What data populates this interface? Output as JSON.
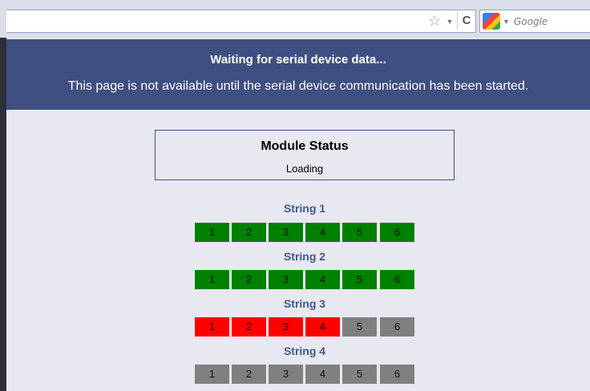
{
  "browser": {
    "search_placeholder": "Google",
    "star_icon": "star-icon",
    "reload_icon": "reload-icon"
  },
  "banner": {
    "title": "Waiting for serial device data...",
    "message": "This page is not available until the serial device communication has been started."
  },
  "module_status": {
    "title": "Module Status",
    "status": "Loading"
  },
  "colors": {
    "banner": "#3e4f82",
    "ok": "#008000",
    "fault": "#ff0000",
    "inactive": "#808080"
  },
  "strings": [
    {
      "label": "String 1",
      "modules": [
        {
          "num": "1",
          "state": "ok"
        },
        {
          "num": "2",
          "state": "ok"
        },
        {
          "num": "3",
          "state": "ok"
        },
        {
          "num": "4",
          "state": "ok"
        },
        {
          "num": "5",
          "state": "ok"
        },
        {
          "num": "6",
          "state": "ok"
        }
      ]
    },
    {
      "label": "String 2",
      "modules": [
        {
          "num": "1",
          "state": "ok"
        },
        {
          "num": "2",
          "state": "ok"
        },
        {
          "num": "3",
          "state": "ok"
        },
        {
          "num": "4",
          "state": "ok"
        },
        {
          "num": "5",
          "state": "ok"
        },
        {
          "num": "6",
          "state": "ok"
        }
      ]
    },
    {
      "label": "String 3",
      "modules": [
        {
          "num": "1",
          "state": "fault"
        },
        {
          "num": "2",
          "state": "fault"
        },
        {
          "num": "3",
          "state": "fault"
        },
        {
          "num": "4",
          "state": "fault"
        },
        {
          "num": "5",
          "state": "inactive"
        },
        {
          "num": "6",
          "state": "inactive"
        }
      ]
    },
    {
      "label": "String 4",
      "modules": [
        {
          "num": "1",
          "state": "inactive"
        },
        {
          "num": "2",
          "state": "inactive"
        },
        {
          "num": "3",
          "state": "inactive"
        },
        {
          "num": "4",
          "state": "inactive"
        },
        {
          "num": "5",
          "state": "inactive"
        },
        {
          "num": "6",
          "state": "inactive"
        }
      ]
    }
  ]
}
